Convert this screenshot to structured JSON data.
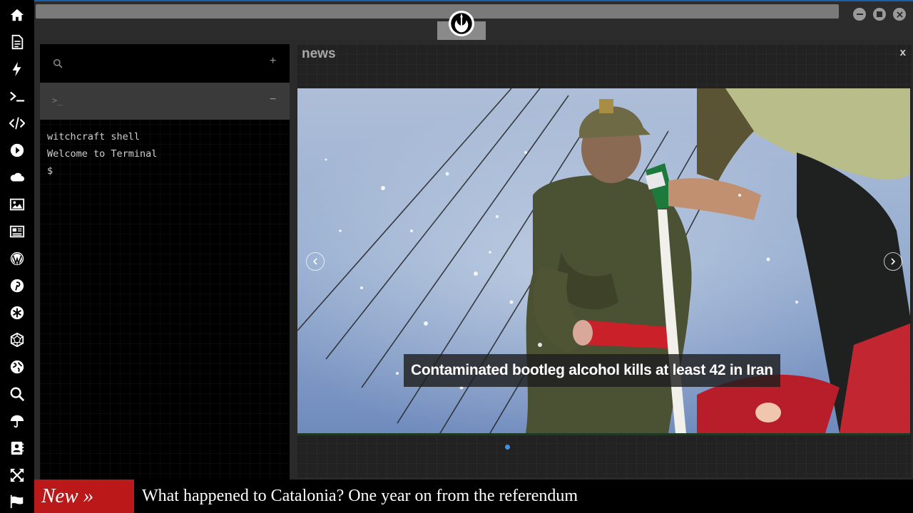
{
  "sidebar": {
    "items": [
      {
        "name": "home-icon"
      },
      {
        "name": "document-icon"
      },
      {
        "name": "lightning-icon"
      },
      {
        "name": "terminal-icon"
      },
      {
        "name": "code-icon"
      },
      {
        "name": "play-icon"
      },
      {
        "name": "cloud-icon"
      },
      {
        "name": "image-icon"
      },
      {
        "name": "newspaper-icon"
      },
      {
        "name": "wordpress-icon"
      },
      {
        "name": "pinterest-icon"
      },
      {
        "name": "asterisk-icon"
      },
      {
        "name": "dodecahedron-icon"
      },
      {
        "name": "globe-icon"
      },
      {
        "name": "search-icon"
      },
      {
        "name": "umbrella-icon"
      },
      {
        "name": "contact-card-icon"
      },
      {
        "name": "expand-icon"
      },
      {
        "name": "flag-icon"
      }
    ]
  },
  "topbar": {
    "logo": "rebel-alliance-logo"
  },
  "left_panel": {
    "search_placeholder": "",
    "add_label": "+",
    "terminal_tab_prompt": ">_",
    "collapse_label": "−",
    "terminal_lines": [
      "witchcraft shell",
      "Welcome to Terminal",
      "$"
    ]
  },
  "news": {
    "title": "news",
    "close_label": "x",
    "headline": "Contaminated bootleg alcohol kills at least 42 in Iran",
    "slide_count": 1,
    "active_slide": 0
  },
  "ticker": {
    "label": "New »",
    "headline": "What happened to Catalonia? One year on from the referendum"
  },
  "colors": {
    "accent_blue": "#1b5fa8",
    "ticker_red": "#bb1919",
    "dot_blue": "#4a90d9"
  }
}
